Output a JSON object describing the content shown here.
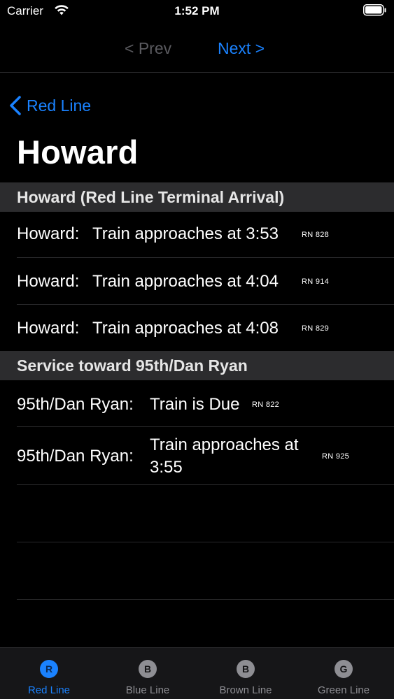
{
  "status_bar": {
    "carrier": "Carrier",
    "time": "1:52 PM"
  },
  "pager": {
    "prev_label": "< Prev",
    "next_label": "Next >"
  },
  "nav": {
    "back_label": "Red Line",
    "title": "Howard"
  },
  "sections": [
    {
      "header": "Howard (Red Line Terminal Arrival)",
      "rows": [
        {
          "station": "Howard:",
          "message": "Train approaches at 3:53",
          "rn": "RN 828"
        },
        {
          "station": "Howard:",
          "message": "Train approaches at 4:04",
          "rn": "RN 914"
        },
        {
          "station": "Howard:",
          "message": "Train approaches at 4:08",
          "rn": "RN 829"
        }
      ]
    },
    {
      "header": "Service toward 95th/Dan Ryan",
      "rows": [
        {
          "station": "95th/Dan Ryan:",
          "message": "Train is Due",
          "rn": "RN 822"
        },
        {
          "station": "95th/Dan Ryan:",
          "message_line1": "Train approaches at",
          "message_line2": "3:55",
          "rn": "RN 925"
        }
      ]
    }
  ],
  "tabs": [
    {
      "icon_letter": "R",
      "label": "Red Line",
      "active": true
    },
    {
      "icon_letter": "B",
      "label": "Blue Line",
      "active": false
    },
    {
      "icon_letter": "B",
      "label": "Brown Line",
      "active": false
    },
    {
      "icon_letter": "G",
      "label": "Green Line",
      "active": false
    }
  ],
  "colors": {
    "accent": "#1a82ff",
    "inactive": "#8e8e93",
    "section_bg": "#2c2c2e",
    "background": "#000000"
  }
}
